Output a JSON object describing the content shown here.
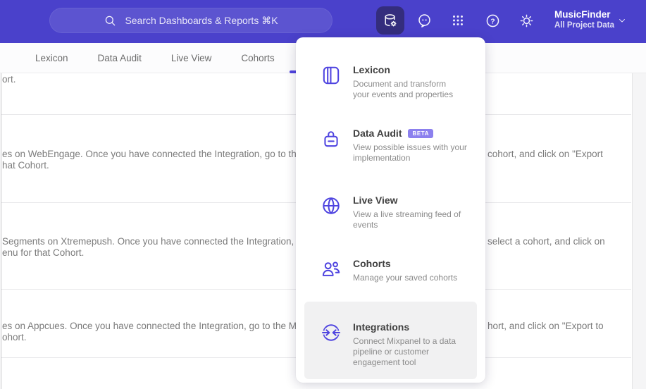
{
  "colors": {
    "accent": "#4f44e0",
    "topbar_bg": "#4a41cb",
    "active_icon_bg": "#342d7d",
    "badge_bg": "#8c80ee",
    "highlight_bg": "#f1f1f2",
    "muted_text": "#7b7b7b",
    "divider": "#e9e9eb"
  },
  "topbar": {
    "search_placeholder": "Search Dashboards & Reports ⌘K",
    "help_glyph": "?",
    "project_name": "MusicFinder",
    "project_subtitle": "All Project Data",
    "icons": [
      "search-icon",
      "data-management-icon",
      "feedback-chat-icon",
      "apps-grid-icon",
      "help-icon",
      "settings-gear-icon",
      "chevron-down-icon"
    ]
  },
  "tabs": [
    {
      "label": "Lexicon"
    },
    {
      "label": "Data Audit"
    },
    {
      "label": "Live View"
    },
    {
      "label": "Cohorts"
    }
  ],
  "menu": {
    "items": [
      {
        "title": "Lexicon",
        "icon": "book-icon",
        "desc": "Document and transform\nyour events and properties"
      },
      {
        "title": "Data Audit",
        "icon": "audit-lock-icon",
        "badge": "BETA",
        "desc": "View possible issues with your\nimplementation"
      },
      {
        "title": "Live View",
        "icon": "globe-icon",
        "desc": "View a live streaming feed of\nevents"
      },
      {
        "title": "Cohorts",
        "icon": "people-icon",
        "desc": "Manage your saved cohorts"
      },
      {
        "title": "Integrations",
        "icon": "sync-arrows-icon",
        "highlighted": true,
        "desc": "Connect Mixpanel to a data\npipeline or customer\nengagement tool"
      }
    ]
  },
  "content": {
    "row1": {
      "left_line1": "ort."
    },
    "row2": {
      "left_line1": "es on WebEngage. Once you have connected the Integration, go to the",
      "right_line1": "cohort, and click on \"Export",
      "left_line2": "hat Cohort."
    },
    "row3": {
      "left_line1": "Segments on Xtremepush. Once you have connected the Integration, ",
      "right_line1": "select a cohort, and click on",
      "left_line2": "enu for that Cohort."
    },
    "row4": {
      "left_line1": "es on Appcues. Once you have connected the Integration, go to the M",
      "right_line1": "hort, and click on \"Export to",
      "left_line2": "ohort."
    }
  }
}
